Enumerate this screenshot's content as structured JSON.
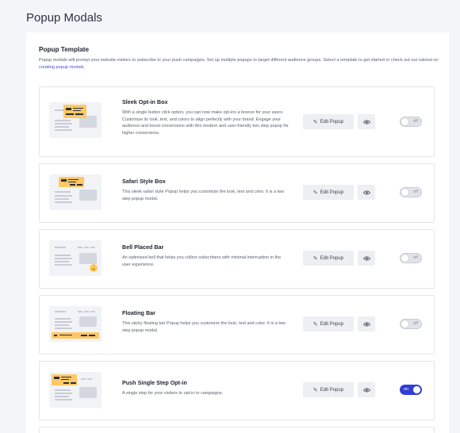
{
  "page": {
    "title": "Popup Modals"
  },
  "section": {
    "title": "Popup Template",
    "description": "Popup modals will prompt your website visitors to subscribe to your push campaigns. Set up multiple popups to target different audience groups. Select a template to get started or check out our tutorial on ",
    "link_text": "creating popup modals",
    "link_suffix": "."
  },
  "actions": {
    "edit_label": "Edit Popup"
  },
  "colors": {
    "accent": "#2f3ed6",
    "thumbnail_highlight": "#ffc863"
  },
  "templates": [
    {
      "name": "Sleek Opt-in Box",
      "description": "With a single button click option, you can now make opt-ins a breeze for your users. Customize its look, text, and colors to align perfectly with your brand. Engage your audience and boost conversions with this modern and user-friendly two step popup for higher conversions.",
      "toggle": "off",
      "enabled": false
    },
    {
      "name": "Safari Style Box",
      "description": "This sleek safari style Popup helps you customize the look, text and color. It is a two step popup modal.",
      "toggle": "off",
      "enabled": false
    },
    {
      "name": "Bell Placed Bar",
      "description": "An optimized bell that helps you collect subscribers with minimal interruption in the user experience.",
      "toggle": "off",
      "enabled": false
    },
    {
      "name": "Floating Bar",
      "description": "This sticky floating bar Popup helps you customize the look, text and color. It is a two step popup modal.",
      "toggle": "off",
      "enabled": false
    },
    {
      "name": "Push Single Step Opt-in",
      "description": "A single step for your visitors to opt-in to campaigns.",
      "toggle": "on",
      "enabled": true
    }
  ]
}
